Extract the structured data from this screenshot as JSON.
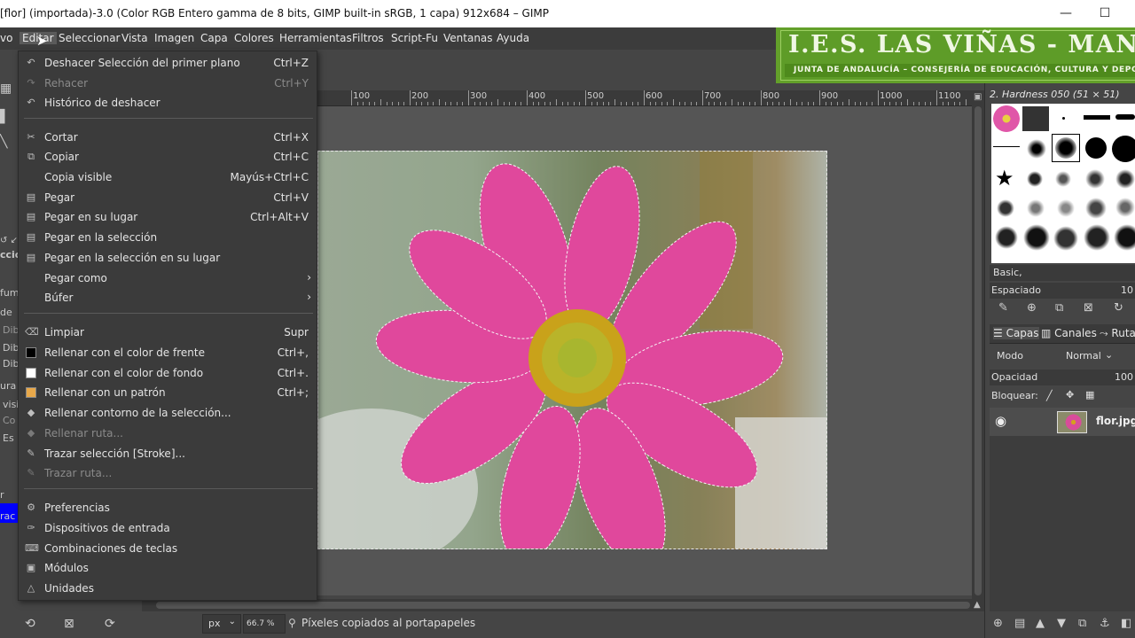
{
  "window": {
    "title": "[flor] (importada)-3.0 (Color RGB Entero gamma de 8 bits, GIMP built-in sRGB, 1 capa) 912x684 – GIMP",
    "minimize_icon": "minimize-icon",
    "maximize_icon": "maximize-icon"
  },
  "menubar": {
    "items": [
      "vo",
      "Editar",
      "Seleccionar",
      "Vista",
      "Imagen",
      "Capa",
      "Colores",
      "Herramientas",
      "Filtros",
      "Script-Fu",
      "Ventanas",
      "Ayuda"
    ],
    "active": "Editar"
  },
  "banner": {
    "title": "I.E.S. LAS VIÑAS - MANILVA",
    "subtitle": "JUNTA DE ANDALUCÍA – CONSEJERÍA DE EDUCACIÓN, CULTURA Y DEPORTE"
  },
  "edit_menu": {
    "items": [
      {
        "label": "Deshacer Selección del primer plano",
        "shortcut": "Ctrl+Z",
        "enabled": true,
        "icon": "undo-icon"
      },
      {
        "label": "Rehacer",
        "shortcut": "Ctrl+Y",
        "enabled": false,
        "icon": "redo-icon"
      },
      {
        "label": "Histórico de deshacer",
        "shortcut": "",
        "enabled": true,
        "icon": "undo-history-icon"
      },
      {
        "label": "Cortar",
        "shortcut": "Ctrl+X",
        "enabled": true,
        "icon": "cut-icon"
      },
      {
        "label": "Copiar",
        "shortcut": "Ctrl+C",
        "enabled": true,
        "icon": "copy-icon"
      },
      {
        "label": "Copia visible",
        "shortcut": "Mayús+Ctrl+C",
        "enabled": true,
        "icon": ""
      },
      {
        "label": "Pegar",
        "shortcut": "Ctrl+V",
        "enabled": true,
        "icon": "paste-icon"
      },
      {
        "label": "Pegar en su lugar",
        "shortcut": "Ctrl+Alt+V",
        "enabled": true,
        "icon": "paste-icon"
      },
      {
        "label": "Pegar en la selección",
        "shortcut": "",
        "enabled": true,
        "icon": "paste-icon"
      },
      {
        "label": "Pegar en la selección en su lugar",
        "shortcut": "",
        "enabled": true,
        "icon": "paste-icon"
      },
      {
        "label": "Pegar como",
        "shortcut": "",
        "enabled": true,
        "icon": "",
        "submenu": true
      },
      {
        "label": "Búfer",
        "shortcut": "",
        "enabled": true,
        "icon": "",
        "submenu": true
      },
      {
        "label": "Limpiar",
        "shortcut": "Supr",
        "enabled": true,
        "icon": "clear-icon"
      },
      {
        "label": "Rellenar con el color de frente",
        "shortcut": "Ctrl+,",
        "enabled": true,
        "icon": "fg-swatch"
      },
      {
        "label": "Rellenar con el color de fondo",
        "shortcut": "Ctrl+.",
        "enabled": true,
        "icon": "bg-swatch"
      },
      {
        "label": "Rellenar con un patrón",
        "shortcut": "Ctrl+;",
        "enabled": true,
        "icon": "pattern-swatch"
      },
      {
        "label": "Rellenar contorno de la selección...",
        "shortcut": "",
        "enabled": true,
        "icon": "bucket-fill-icon"
      },
      {
        "label": "Rellenar ruta...",
        "shortcut": "",
        "enabled": false,
        "icon": "bucket-fill-icon"
      },
      {
        "label": "Trazar selección [Stroke]...",
        "shortcut": "",
        "enabled": true,
        "icon": "stroke-icon"
      },
      {
        "label": "Trazar ruta...",
        "shortcut": "",
        "enabled": false,
        "icon": "stroke-icon"
      },
      {
        "label": "Preferencias",
        "shortcut": "",
        "enabled": true,
        "icon": "preferences-icon"
      },
      {
        "label": "Dispositivos de entrada",
        "shortcut": "",
        "enabled": true,
        "icon": "input-devices-icon"
      },
      {
        "label": "Combinaciones de teclas",
        "shortcut": "",
        "enabled": true,
        "icon": "keyboard-icon"
      },
      {
        "label": "Módulos",
        "shortcut": "",
        "enabled": true,
        "icon": "modules-icon"
      },
      {
        "label": "Unidades",
        "shortcut": "",
        "enabled": true,
        "icon": "units-icon"
      }
    ]
  },
  "ruler": {
    "labels": [
      "100",
      "200",
      "300",
      "400",
      "500",
      "600",
      "700",
      "800",
      "900",
      "1000",
      "1100"
    ]
  },
  "toolbox_fragments": [
    "cció",
    "fum",
    "de",
    "Dib",
    "Dib",
    "Dib",
    "ura",
    "visi",
    "Co",
    "Es",
    "r",
    "rac"
  ],
  "colors": {
    "foreground": "#0000ff",
    "background": "#ffffff",
    "pattern": "#e8a84a",
    "menu_bg": "#3b3b3b",
    "banner_green": "#63a02a"
  },
  "statusbar": {
    "unit": "px",
    "zoom": "66.7 %",
    "message": "Píxeles copiados al portapapeles"
  },
  "brushes": {
    "title": "2. Hardness 050 (51 × 51)",
    "preset": "Basic,",
    "spacing_label": "Espaciado",
    "spacing_value": "10"
  },
  "layers": {
    "tabs": [
      "Capas",
      "Canales",
      "Rutas"
    ],
    "mode_label": "Modo",
    "mode_value": "Normal",
    "opacity_label": "Opacidad",
    "opacity_value": "100",
    "lock_label": "Bloquear:",
    "items": [
      {
        "name": "flor.jpg",
        "visible": true
      }
    ]
  }
}
